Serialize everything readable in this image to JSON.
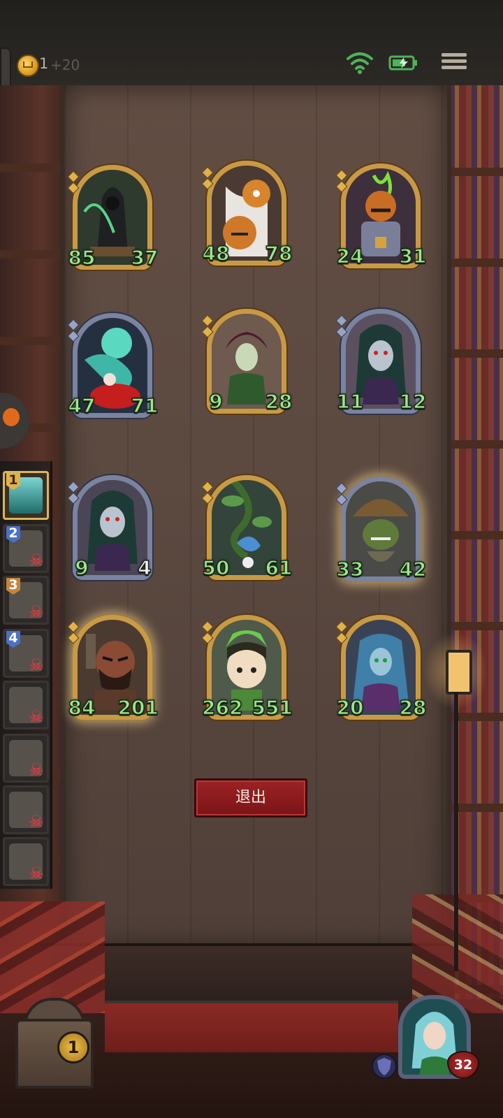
{
  "top_bar": {
    "gold": "1",
    "gold_income": "+20",
    "status_icons": [
      "wifi-icon",
      "battery-charging-icon"
    ],
    "menu_icon": "hamburger-menu-icon"
  },
  "cards": [
    {
      "attack": "85",
      "health": "37",
      "frame": "gold"
    },
    {
      "attack": "48",
      "health": "78",
      "frame": "gold"
    },
    {
      "attack": "24",
      "health": "31",
      "frame": "gold"
    },
    {
      "attack": "47",
      "health": "71",
      "frame": "silver"
    },
    {
      "attack": "9",
      "health": "28",
      "frame": "gold"
    },
    {
      "attack": "11",
      "health": "12",
      "frame": "silver"
    },
    {
      "attack": "9",
      "health": "4",
      "frame": "silver"
    },
    {
      "attack": "50",
      "health": "61",
      "frame": "gold"
    },
    {
      "attack": "33",
      "health": "42",
      "frame": "silver"
    },
    {
      "attack": "84",
      "health": "201",
      "frame": "gold"
    },
    {
      "attack": "262",
      "health": "551",
      "frame": "gold"
    },
    {
      "attack": "20",
      "health": "28",
      "frame": "gold"
    }
  ],
  "exit_button": {
    "label": "退出"
  },
  "rankings": [
    {
      "rank": "1",
      "status": "alive"
    },
    {
      "rank": "2",
      "status": "eliminated"
    },
    {
      "rank": "3",
      "status": "eliminated"
    },
    {
      "rank": "4",
      "status": "eliminated"
    },
    {
      "rank": "",
      "status": "eliminated"
    },
    {
      "rank": "",
      "status": "eliminated"
    },
    {
      "rank": "",
      "status": "eliminated"
    },
    {
      "rank": "",
      "status": "eliminated"
    }
  ],
  "bottom": {
    "chest_count": "1",
    "hero_health": "32",
    "shield_icon": "shield-icon"
  },
  "colors": {
    "stat_green": "#9be88a",
    "gold_frame": "#c89a46",
    "silver_frame": "#7a83a0",
    "exit_red": "#9b2224",
    "eliminated_red": "#ff3440"
  }
}
